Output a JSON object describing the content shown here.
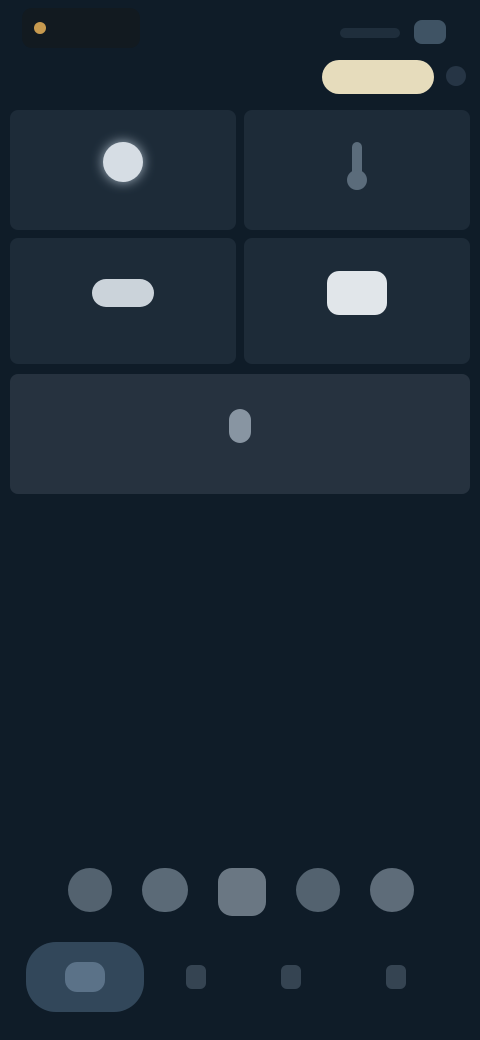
{
  "header": {
    "brand_label": "",
    "action_label": ""
  },
  "section": {
    "title": ""
  },
  "tiles": [
    {
      "icon": "sun-icon",
      "label": ""
    },
    {
      "icon": "thermometer-icon",
      "label": ""
    },
    {
      "icon": "cloud-icon",
      "label": ""
    },
    {
      "icon": "screen-icon",
      "label": ""
    },
    {
      "icon": "person-icon",
      "label": ""
    }
  ],
  "dock": {
    "title": ""
  },
  "colors": {
    "background": "#0f1c28",
    "tile": "#1d2b38",
    "accent": "#e6dcbc",
    "brand": "#c79a4f"
  }
}
